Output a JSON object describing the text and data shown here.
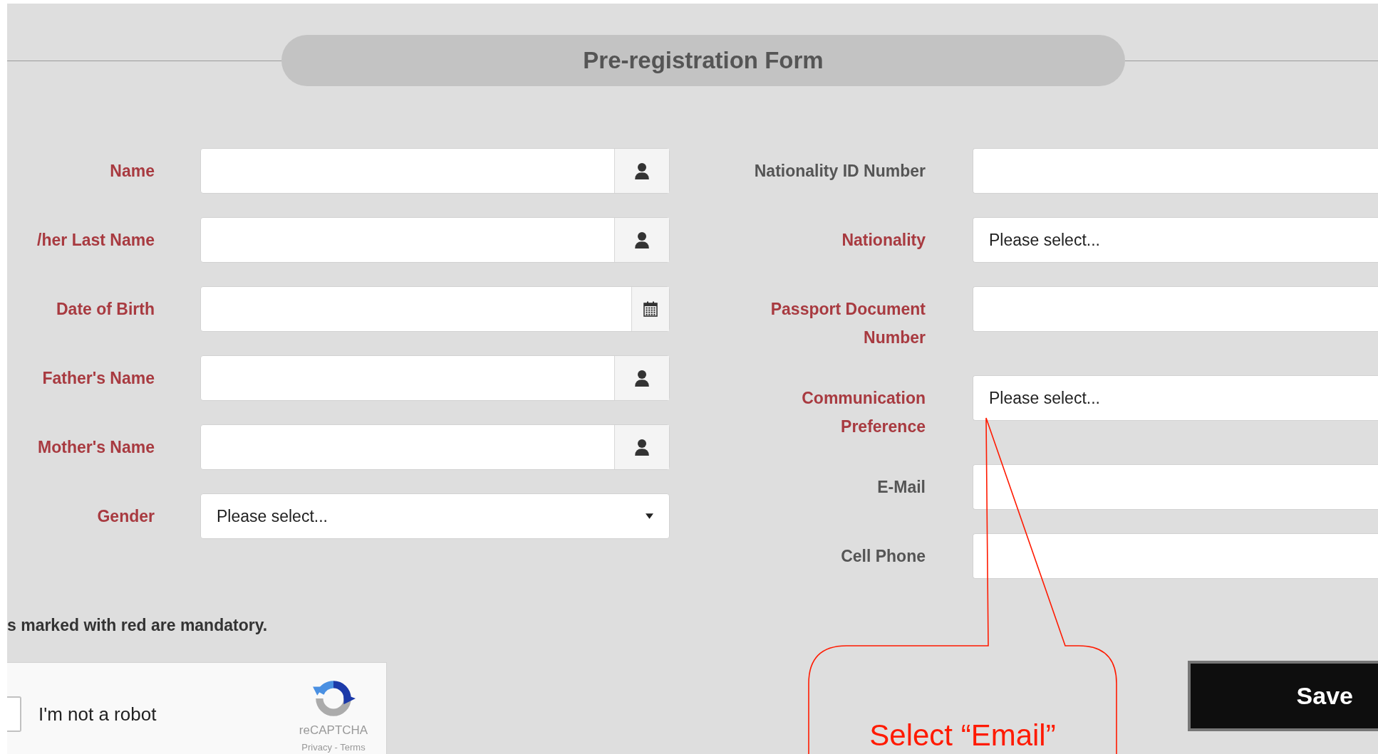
{
  "header": {
    "title": "Pre-registration Form"
  },
  "left_fields": [
    {
      "label": "Name",
      "required": true,
      "kind": "person"
    },
    {
      "label": "/her Last Name",
      "required": true,
      "kind": "person"
    },
    {
      "label": "Date of Birth",
      "required": true,
      "kind": "date"
    },
    {
      "label": "Father's Name",
      "required": true,
      "kind": "person"
    },
    {
      "label": "Mother's Name",
      "required": true,
      "kind": "person"
    },
    {
      "label": "Gender",
      "required": true,
      "kind": "select",
      "value": "Please select..."
    }
  ],
  "right_fields": [
    {
      "label": "Nationality ID Number",
      "required": false
    },
    {
      "label": "Nationality",
      "required": true,
      "value": "Please select..."
    },
    {
      "label": "Passport Document Number",
      "required": true
    },
    {
      "label": "Communication Preference",
      "required": true,
      "value": "Please select..."
    },
    {
      "label": "E-Mail",
      "required": false
    },
    {
      "label": "Cell Phone",
      "required": false
    }
  ],
  "mandatory_note": "s marked with red are mandatory.",
  "captcha": {
    "label": "I'm not a robot",
    "checked": false,
    "brand": "reCAPTCHA",
    "links": "Privacy - Terms"
  },
  "save_button": "Save",
  "annotation": {
    "text": "Select “Email”"
  }
}
